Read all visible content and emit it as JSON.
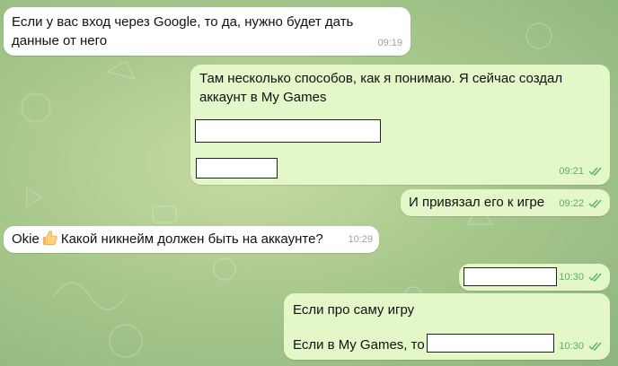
{
  "chat": {
    "messages": [
      {
        "direction": "incoming",
        "lines": [
          "Если у вас вход через Google, то да, нужно будет дать",
          "данные от него"
        ],
        "time": "09:19"
      },
      {
        "direction": "outgoing",
        "lines": [
          "Там несколько способов, как я понимаю. Я сейчас создал",
          "аккаунт в My Games"
        ],
        "time": "09:21",
        "status": "read"
      },
      {
        "direction": "outgoing",
        "lines": [
          "И привязал его к игре"
        ],
        "time": "09:22",
        "status": "read"
      },
      {
        "direction": "incoming",
        "prefix": "Okie",
        "emoji": "thumbs-up-emoji",
        "lines": [
          "Какой никнейм должен быть на аккаунте?"
        ],
        "time": "10:29"
      },
      {
        "direction": "outgoing",
        "lines": [],
        "time": "10:30",
        "status": "read"
      },
      {
        "direction": "outgoing",
        "lines": [
          "Если про саму игру",
          "Если в My Games, то"
        ],
        "time": "10:30",
        "status": "read"
      }
    ]
  },
  "colors": {
    "incoming_bubble": "#ffffff",
    "outgoing_bubble": "#e3f7c8",
    "read_check": "#59b15e",
    "wallpaper": "#a9c98d"
  }
}
